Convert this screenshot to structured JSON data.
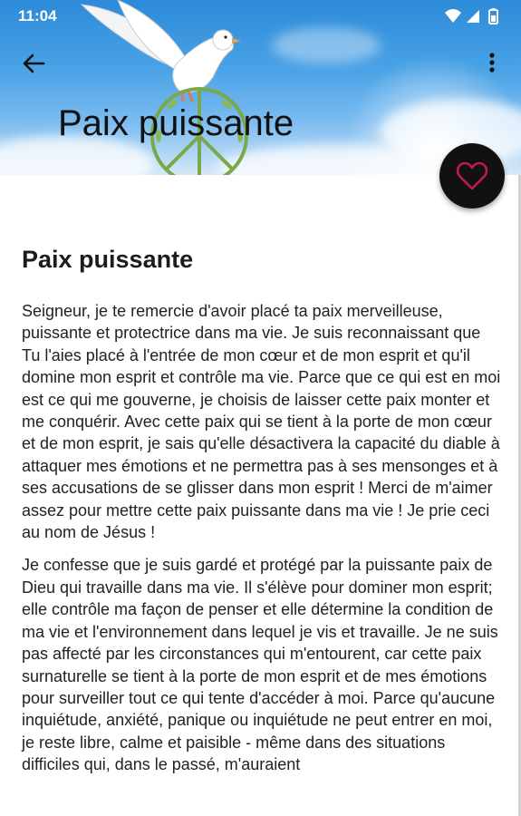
{
  "status_bar": {
    "time": "11:04",
    "icons": [
      "wifi-icon",
      "cellular-signal-icon",
      "battery-icon"
    ]
  },
  "toolbar": {
    "title": "Paix puissante",
    "back_icon": "arrow-back-icon",
    "menu_icon": "more-vert-icon"
  },
  "fab": {
    "icon": "heart-outline-icon",
    "icon_color": "#c2185b",
    "background": "#111111"
  },
  "article": {
    "title": "Paix puissante",
    "paragraphs": [
      "Seigneur, je te remercie d'avoir placé ta paix merveilleuse, puissante et protectrice dans ma vie. Je suis reconnaissant que Tu l'aies placé à l'entrée de mon cœur et de mon esprit et qu'il domine mon esprit et contrôle ma vie. Parce que ce qui est en moi est ce qui me gouverne, je choisis de laisser cette paix monter et me conquérir. Avec cette paix qui se tient à la porte de mon cœur et de mon esprit, je sais qu'elle désactivera la capacité du diable à attaquer mes émotions et ne permettra pas à ses mensonges et à ses accusations de se glisser dans mon esprit ! Merci de m'aimer assez pour mettre cette paix puissante dans ma vie ! Je prie ceci au nom de Jésus !",
      "Je confesse que je suis gardé et protégé par la puissante paix de Dieu qui travaille dans ma vie. Il s'élève pour dominer mon esprit; elle contrôle ma façon de penser et elle détermine la condition de ma vie et l'environnement dans lequel je vis et travaille. Je ne suis pas affecté par les circonstances qui m'entourent, car cette paix surnaturelle se tient à la porte de mon esprit et de mes émotions pour surveiller tout ce qui tente d'accéder à moi. Parce qu'aucune inquiétude, anxiété, panique ou inquiétude ne peut entrer en moi, je reste libre, calme et paisible - même dans des situations difficiles qui, dans le passé, m'auraient"
    ]
  },
  "colors": {
    "sky_top": "#2c8ad8",
    "sky_bottom": "#d6e8f7",
    "text": "#222222"
  }
}
